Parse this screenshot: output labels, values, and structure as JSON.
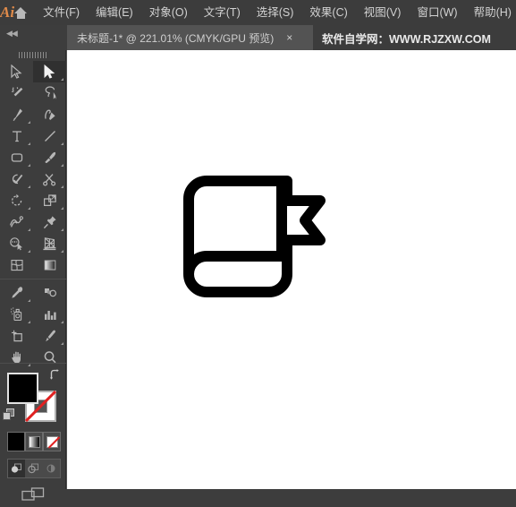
{
  "app": {
    "name": "Adobe Illustrator",
    "logo_text": "Ai"
  },
  "menubar": {
    "home_icon": "home-icon",
    "items": [
      {
        "label": "文件(F)",
        "name": "menu-file"
      },
      {
        "label": "编辑(E)",
        "name": "menu-edit"
      },
      {
        "label": "对象(O)",
        "name": "menu-object"
      },
      {
        "label": "文字(T)",
        "name": "menu-type"
      },
      {
        "label": "选择(S)",
        "name": "menu-select"
      },
      {
        "label": "效果(C)",
        "name": "menu-effect"
      },
      {
        "label": "视图(V)",
        "name": "menu-view"
      },
      {
        "label": "窗口(W)",
        "name": "menu-window"
      },
      {
        "label": "帮助(H)",
        "name": "menu-help"
      }
    ]
  },
  "tabbar": {
    "collapse_glyph": "◀◀",
    "document_tab": {
      "title": "未标题-1* @ 221.01% (CMYK/GPU 预览)",
      "close_glyph": "×",
      "doc_name": "未标题-1*",
      "zoom_level": "221.01%",
      "color_mode": "CMYK/GPU 预览",
      "modified": true
    },
    "brand_text": "软件自学网：WWW.RJZXW.COM"
  },
  "toolpanel": {
    "rows": [
      [
        {
          "name": "selection-tool",
          "icon": "arrow-solid",
          "selected": false,
          "corner": false
        },
        {
          "name": "direct-selection-tool",
          "icon": "arrow-filled",
          "selected": true,
          "corner": true
        }
      ],
      [
        {
          "name": "magic-wand-tool",
          "icon": "magic-wand",
          "selected": false,
          "corner": false
        },
        {
          "name": "lasso-tool",
          "icon": "lasso",
          "selected": false,
          "corner": false
        }
      ],
      [
        {
          "name": "pen-tool",
          "icon": "pen",
          "selected": false,
          "corner": true
        },
        {
          "name": "curvature-tool",
          "icon": "curvature",
          "selected": false,
          "corner": false
        }
      ],
      [
        {
          "name": "type-tool",
          "icon": "type-T",
          "selected": false,
          "corner": true
        },
        {
          "name": "line-segment-tool",
          "icon": "line-segment",
          "selected": false,
          "corner": true
        }
      ],
      [
        {
          "name": "rectangle-tool",
          "icon": "rounded-rectangle",
          "selected": false,
          "corner": true
        },
        {
          "name": "paintbrush-tool",
          "icon": "paintbrush",
          "selected": false,
          "corner": true
        }
      ],
      [
        {
          "name": "shaper-tool",
          "icon": "shaper-pencil",
          "selected": false,
          "corner": true
        },
        {
          "name": "scissors-tool",
          "icon": "scissors",
          "selected": false,
          "corner": true
        }
      ],
      [
        {
          "name": "rotate-tool",
          "icon": "rotate",
          "selected": false,
          "corner": true
        },
        {
          "name": "scale-tool",
          "icon": "scale",
          "selected": false,
          "corner": true
        }
      ],
      [
        {
          "name": "width-tool",
          "icon": "width-warp",
          "selected": false,
          "corner": true
        },
        {
          "name": "free-transform-tool",
          "icon": "pushpin",
          "selected": false,
          "corner": true
        }
      ],
      [
        {
          "name": "shape-builder-tool",
          "icon": "shape-builder",
          "selected": false,
          "corner": true
        },
        {
          "name": "perspective-grid-tool",
          "icon": "perspective-grid",
          "selected": false,
          "corner": true
        }
      ],
      [
        {
          "name": "mesh-tool",
          "icon": "mesh",
          "selected": false,
          "corner": false
        },
        {
          "name": "gradient-tool",
          "icon": "gradient-swatch",
          "selected": false,
          "corner": false
        }
      ],
      [
        {
          "name": "eyedropper-tool",
          "icon": "eyedropper",
          "selected": false,
          "corner": true
        },
        {
          "name": "blend-tool",
          "icon": "blend",
          "selected": false,
          "corner": false
        }
      ],
      [
        {
          "name": "symbol-sprayer-tool",
          "icon": "symbol-sprayer",
          "selected": false,
          "corner": true
        },
        {
          "name": "column-graph-tool",
          "icon": "bar-chart",
          "selected": false,
          "corner": true
        }
      ],
      [
        {
          "name": "artboard-tool",
          "icon": "artboard",
          "selected": false,
          "corner": false
        },
        {
          "name": "slice-tool",
          "icon": "slice-knife",
          "selected": false,
          "corner": true
        }
      ],
      [
        {
          "name": "hand-tool",
          "icon": "hand",
          "selected": false,
          "corner": true
        },
        {
          "name": "zoom-tool",
          "icon": "magnifier",
          "selected": false,
          "corner": false
        }
      ]
    ],
    "colors": {
      "fill_label": "填色",
      "fill_color": "#000000",
      "stroke_label": "描边",
      "stroke_color": "#ffffff",
      "swap_glyph": "⤴",
      "swap_name": "swap-fill-stroke-icon",
      "default_name": "default-fill-stroke-icon"
    },
    "paint_modes": [
      {
        "name": "color-mode-button",
        "label": "颜色",
        "active": true
      },
      {
        "name": "gradient-mode-button",
        "label": "渐变",
        "active": false
      },
      {
        "name": "none-mode-button",
        "label": "无",
        "active": false
      }
    ],
    "draw_modes": [
      {
        "name": "draw-normal-button",
        "label": "正常绘图",
        "active": true
      },
      {
        "name": "draw-behind-button",
        "label": "背面绘图",
        "active": false
      },
      {
        "name": "draw-inside-button",
        "label": "内部绘图",
        "active": false
      }
    ],
    "screen_mode": {
      "name": "change-screen-mode-button",
      "label": "更改屏幕模式"
    }
  },
  "canvas": {
    "background": "#ffffff",
    "artwork": {
      "name": "book-with-bookmark-ribbon",
      "description": "黑色描边书本与书签丝带图形",
      "stroke_color": "#000000",
      "fill_color": "#ffffff"
    }
  }
}
